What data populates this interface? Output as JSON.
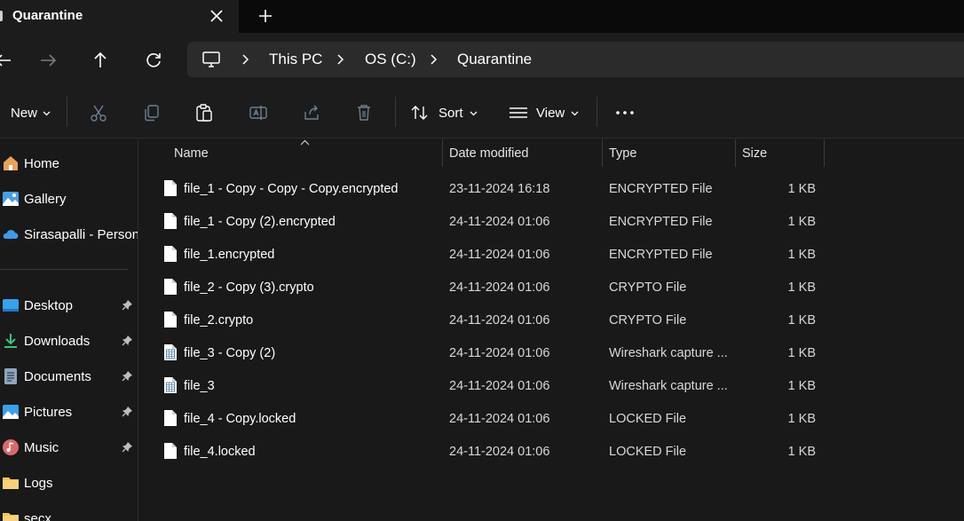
{
  "tab": {
    "title": "Quarantine"
  },
  "breadcrumb": [
    "This PC",
    "OS (C:)",
    "Quarantine"
  ],
  "commands": {
    "new_label": "New",
    "sort_label": "Sort",
    "view_label": "View"
  },
  "sidebar": {
    "items": [
      {
        "label": "Home",
        "icon": "home-icon",
        "pinned": false
      },
      {
        "label": "Gallery",
        "icon": "gallery-icon",
        "pinned": false
      },
      {
        "label": "Sirasapalli - Persona",
        "icon": "onedrive-icon",
        "pinned": false
      },
      {
        "label": "Desktop",
        "icon": "desktop-icon",
        "pinned": true
      },
      {
        "label": "Downloads",
        "icon": "downloads-icon",
        "pinned": true
      },
      {
        "label": "Documents",
        "icon": "documents-icon",
        "pinned": true
      },
      {
        "label": "Pictures",
        "icon": "pictures-icon",
        "pinned": true
      },
      {
        "label": "Music",
        "icon": "music-icon",
        "pinned": true
      },
      {
        "label": "Logs",
        "icon": "folder-icon",
        "pinned": false
      },
      {
        "label": "secx",
        "icon": "folder-icon",
        "pinned": false
      }
    ]
  },
  "columns": {
    "name": "Name",
    "date": "Date modified",
    "type": "Type",
    "size": "Size"
  },
  "files": [
    {
      "name": "file_1 - Copy - Copy - Copy.encrypted",
      "date": "23-11-2024 16:18",
      "type": "ENCRYPTED File",
      "size": "1 KB",
      "icon": "blank-file-icon"
    },
    {
      "name": "file_1 - Copy (2).encrypted",
      "date": "24-11-2024 01:06",
      "type": "ENCRYPTED File",
      "size": "1 KB",
      "icon": "blank-file-icon"
    },
    {
      "name": "file_1.encrypted",
      "date": "24-11-2024 01:06",
      "type": "ENCRYPTED File",
      "size": "1 KB",
      "icon": "blank-file-icon"
    },
    {
      "name": "file_2 - Copy (3).crypto",
      "date": "24-11-2024 01:06",
      "type": "CRYPTO File",
      "size": "1 KB",
      "icon": "blank-file-icon"
    },
    {
      "name": "file_2.crypto",
      "date": "24-11-2024 01:06",
      "type": "CRYPTO File",
      "size": "1 KB",
      "icon": "blank-file-icon"
    },
    {
      "name": "file_3 - Copy (2)",
      "date": "24-11-2024 01:06",
      "type": "Wireshark capture ...",
      "size": "1 KB",
      "icon": "capture-file-icon"
    },
    {
      "name": "file_3",
      "date": "24-11-2024 01:06",
      "type": "Wireshark capture ...",
      "size": "1 KB",
      "icon": "capture-file-icon"
    },
    {
      "name": "file_4 - Copy.locked",
      "date": "24-11-2024 01:06",
      "type": "LOCKED File",
      "size": "1 KB",
      "icon": "blank-file-icon"
    },
    {
      "name": "file_4.locked",
      "date": "24-11-2024 01:06",
      "type": "LOCKED File",
      "size": "1 KB",
      "icon": "blank-file-icon"
    }
  ],
  "colors": {
    "background": "#191919",
    "toolbar": "#1c1c1c",
    "address_bar": "#2b2b2b",
    "accent": "#4cc2ff"
  }
}
